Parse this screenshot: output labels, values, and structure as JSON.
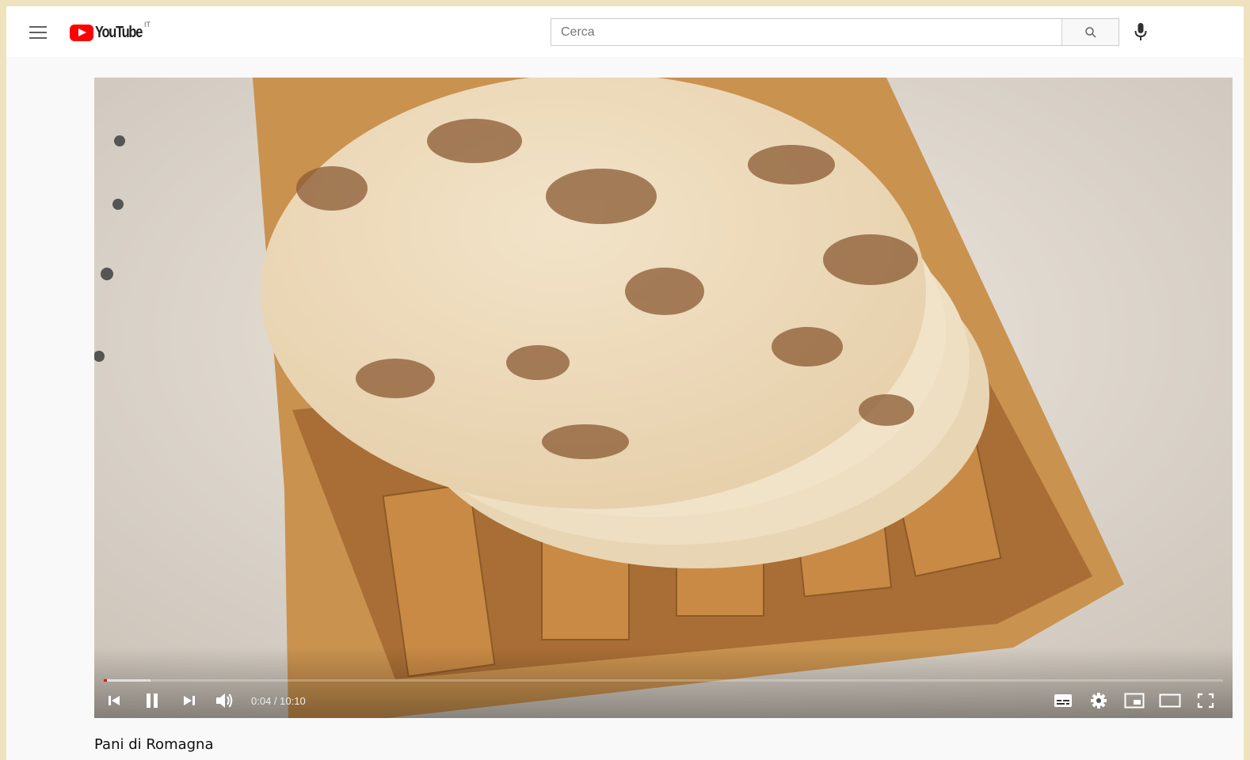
{
  "header": {
    "logo_text": "YouTube",
    "country_code": "IT",
    "search_placeholder": "Cerca"
  },
  "player": {
    "current_time": "0:04",
    "separator": " / ",
    "duration": "10:10",
    "progress_played_fraction": 0.003,
    "progress_loaded_fraction": 0.042,
    "icons": [
      "previous-icon",
      "pause-icon",
      "next-icon",
      "volume-icon",
      "subtitles-icon",
      "settings-icon",
      "miniplayer-icon",
      "theater-mode-icon",
      "fullscreen-icon"
    ]
  },
  "video": {
    "title": "Pani di Romagna"
  },
  "colors": {
    "brand": "#ff0000",
    "progress_played": "#ff0000"
  }
}
